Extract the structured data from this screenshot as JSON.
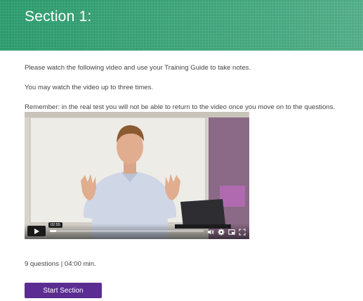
{
  "header": {
    "title": "Section 1:"
  },
  "instructions": {
    "line1": "Please watch the following video and use your Training Guide to take notes.",
    "line2": "You may watch the video up to three times.",
    "line3": "Remember: in the real test you will not be able to return to the video once you move on to the questions."
  },
  "video": {
    "hover_time": "02:55",
    "progress_fraction": 0.04,
    "controls": {
      "play": "play-icon",
      "volume": "volume-icon",
      "settings": "gear-icon",
      "pip": "picture-in-picture-icon",
      "fullscreen": "fullscreen-icon"
    }
  },
  "section_meta": "9 questions | 04:00 min.",
  "start_button": {
    "label": "Start Section"
  },
  "colors": {
    "header_green": "#2a9a6c",
    "button_purple": "#5b2c91"
  }
}
